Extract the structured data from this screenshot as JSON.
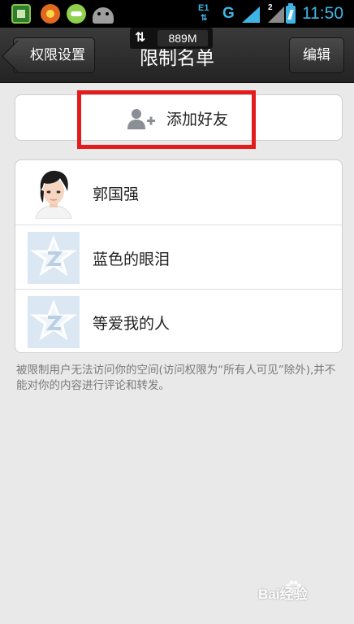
{
  "status_bar": {
    "network_label": "E1",
    "network_type": "G",
    "sim_number": "2",
    "time": "11:50",
    "icons": [
      "app-icon",
      "browser-icon",
      "messenger-icon",
      "android-icon",
      "signal-icon",
      "battery-icon"
    ]
  },
  "memory_overlay": {
    "value": "889M"
  },
  "title_bar": {
    "back_label": "权限设置",
    "title": "限制名单",
    "edit_label": "编辑"
  },
  "add_friend": {
    "label": "添加好友",
    "icon": "add-user-icon"
  },
  "restricted_list": {
    "items": [
      {
        "name": "郭国强",
        "avatar": "photo"
      },
      {
        "name": "蓝色的眼泪",
        "avatar": "default"
      },
      {
        "name": "等爱我的人",
        "avatar": "default"
      }
    ]
  },
  "note": "被限制用户无法访问你的空间(访问权限为“所有人可见”除外),并不能对你的内容进行评论和转发。",
  "watermark": "Bai经验",
  "colors": {
    "highlight": "#e31b1b",
    "accent": "#3fb5e6",
    "title_bar": "#2e2e2e",
    "background": "#e9e9e9"
  }
}
